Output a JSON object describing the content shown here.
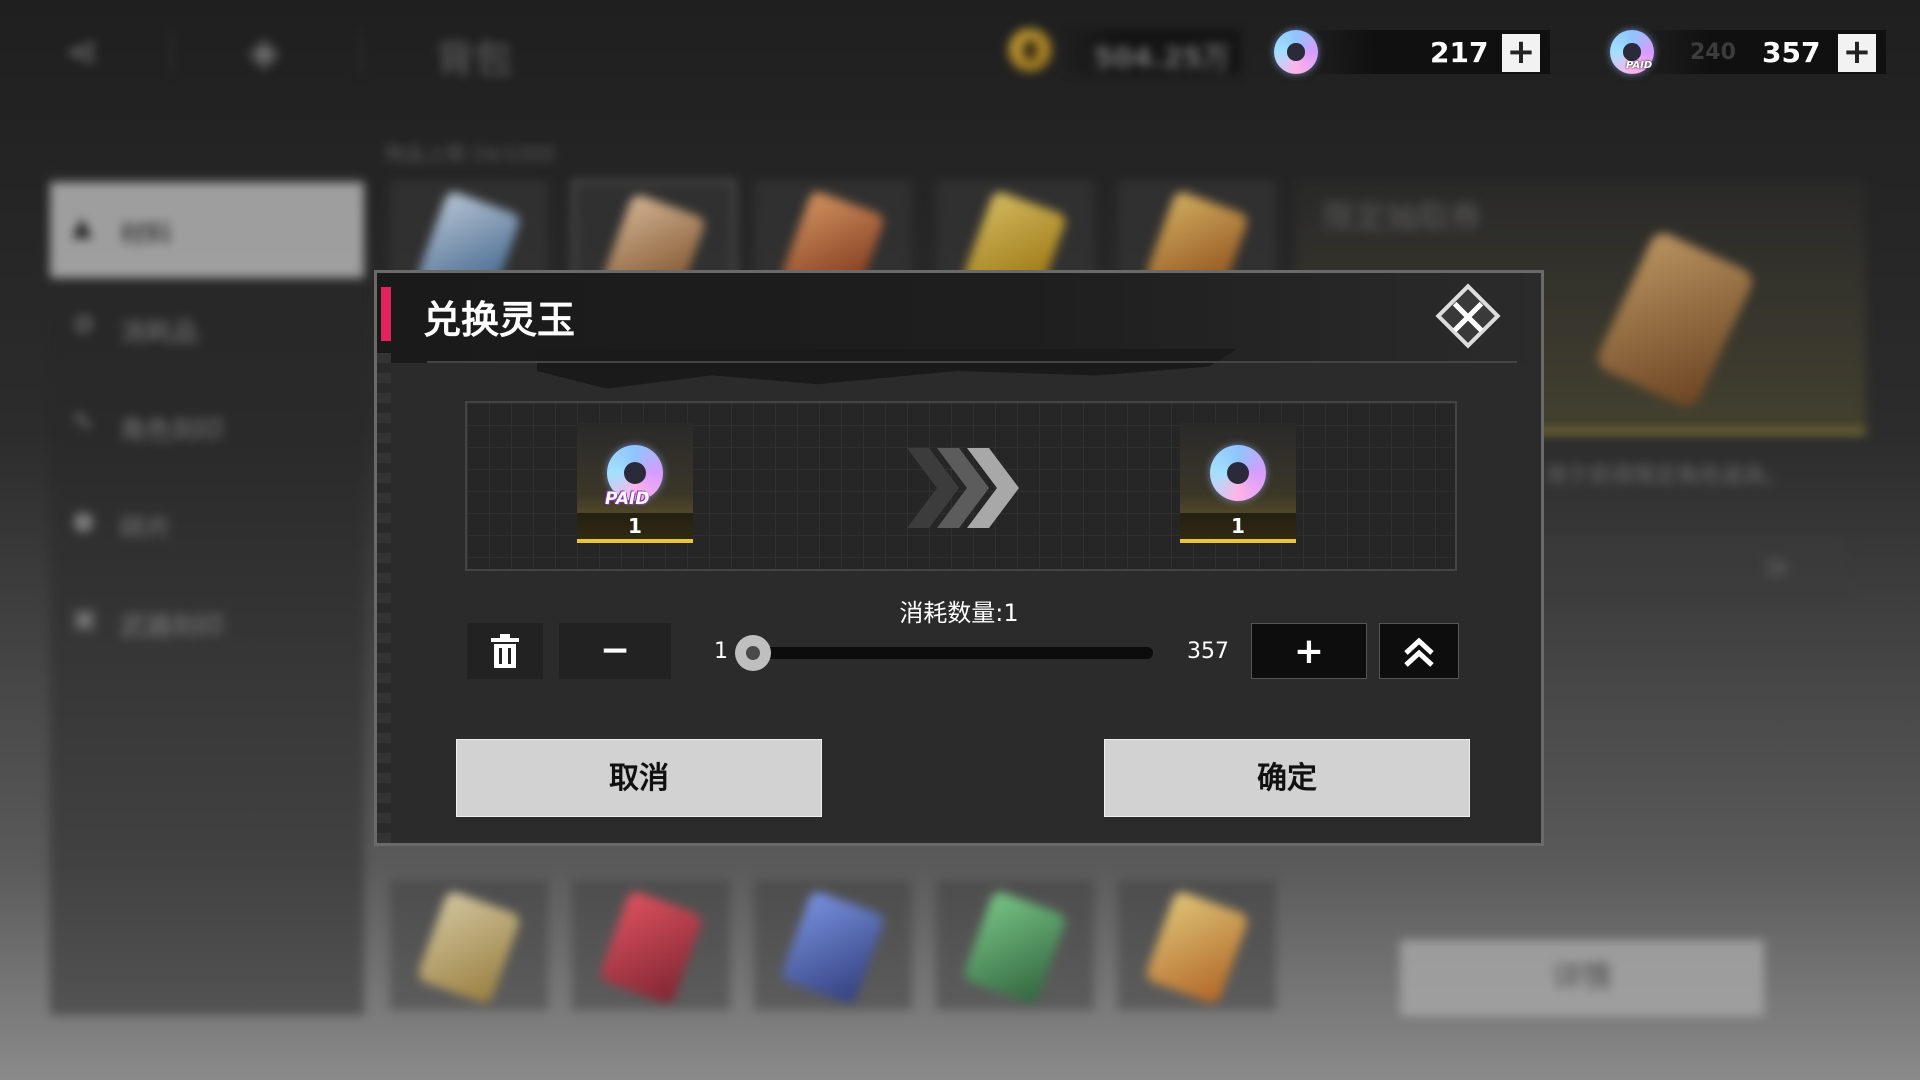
{
  "topbar": {
    "title": "背包",
    "gold_amount": "504.25万",
    "gem_amount": "217",
    "paid_gem_secondary": "240",
    "paid_gem_amount": "357",
    "plus_label": "+",
    "paid_tag": "PAID"
  },
  "sidebar": {
    "items": [
      {
        "label": "材料",
        "icon": "triangle-icon"
      },
      {
        "label": "消耗品",
        "icon": "gear-icon"
      },
      {
        "label": "角色刻印",
        "icon": "brush-icon"
      },
      {
        "label": "碎片",
        "icon": "person-icon"
      },
      {
        "label": "武器刻印",
        "icon": "tablet-icon"
      }
    ]
  },
  "inventory": {
    "capacity_label": "物品上限:34/1000"
  },
  "detail": {
    "title": "限定抽取券",
    "description": "用于获得限定角色道具。",
    "button_label": "详情"
  },
  "dialog": {
    "title": "兑换灵玉",
    "from": {
      "tag": "PAID",
      "qty": "1"
    },
    "to": {
      "qty": "1"
    },
    "consume_label": "消耗数量:1",
    "slider": {
      "min": "1",
      "max": "357",
      "value": 1
    },
    "minus_label": "−",
    "plus_label": "+",
    "cancel_label": "取消",
    "confirm_label": "确定"
  },
  "colors": {
    "accent": "#e0245e",
    "card_gold": "#e8c53a"
  }
}
